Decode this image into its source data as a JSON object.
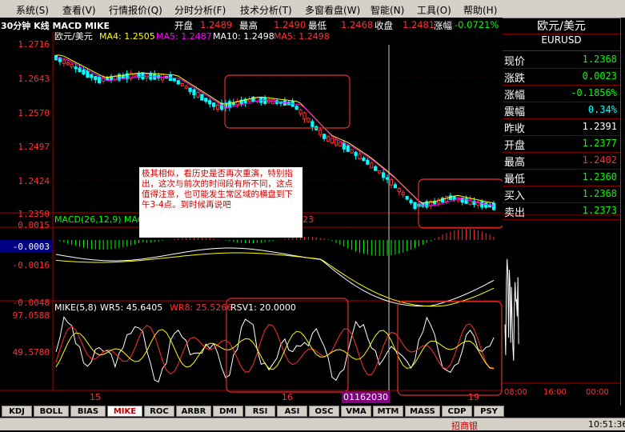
{
  "menu": [
    "系统(S)",
    "查看(V)",
    "行情报价(Q)",
    "分时分析(F)",
    "技术分析(T)",
    "多窗看盘(W)",
    "智能(N)",
    "工具(O)",
    "帮助(H)"
  ],
  "info": {
    "period": "30分钟 K线 MACD MIKE",
    "open_label": "开盘",
    "open": "1.2489",
    "high_label": "最高",
    "high": "1.2490",
    "low_label": "最低",
    "low": "1.2468",
    "close_label": "收盘",
    "close": "1.2481",
    "change_label": "涨幅",
    "change": "-0.0721%"
  },
  "main_legend": {
    "name": "欧元/美元",
    "ma4": "MA4: 1.2505",
    "ma5": "MA5: 1.2487",
    "ma10": "MA10: 1.2498",
    "ma5b": "MA5: 1.2498"
  },
  "price_axis": [
    "1.2716",
    "1.2643",
    "1.2570",
    "1.2497",
    "1.2424",
    "1.2350"
  ],
  "macd": {
    "legend": "MACD(26,12,9)",
    "legend2": "MAC",
    "legend3": "23",
    "axis": [
      "0.0015",
      "-0.0003",
      "-0.0016",
      "-0.0048"
    ]
  },
  "mike": {
    "legend": "MIKE(5,8)",
    "wr5": "WR5: 45.6405",
    "wr8": "WR8: 25.5266",
    "rsv1": "RSV1: 20.0000",
    "axis": [
      "97.0588",
      "49.5780"
    ]
  },
  "dates": [
    "15",
    "16",
    "19"
  ],
  "cursor_time": "01162030",
  "annotation": "极其相似，看历史是否再次重演，特别指出，这次与前次的时间段有所不同，这点值得注意，也可能发生常区域的横盘到下午3-4点。到时候再说吧",
  "right_panel": {
    "title": "欧元/美元",
    "code": "EURUSD",
    "rows": [
      {
        "label": "现价",
        "value": "1.2368",
        "color": "#00ff00"
      },
      {
        "label": "涨跌",
        "value": "0.0023",
        "color": "#00ff00"
      },
      {
        "label": "涨幅",
        "value": "-0.1856%",
        "color": "#00ff00"
      },
      {
        "label": "震幅",
        "value": "0.34%",
        "color": "#00ffff"
      },
      {
        "label": "昨收",
        "value": "1.2391",
        "color": "#ffffff"
      },
      {
        "label": "开盘",
        "value": "1.2377",
        "color": "#00ff00"
      },
      {
        "label": "最高",
        "value": "1.2402",
        "color": "#ff3030"
      },
      {
        "label": "最低",
        "value": "1.2360",
        "color": "#00ff00"
      },
      {
        "label": "买入",
        "value": "1.2368",
        "color": "#00ff00"
      },
      {
        "label": "卖出",
        "value": "1.2373",
        "color": "#00ff00"
      }
    ]
  },
  "mini_axis": [
    "08:00",
    "16:00",
    "00:00"
  ],
  "tabs": [
    "KDJ",
    "BOLL",
    "BIAS",
    "MIKE",
    "ROC",
    "ARBR",
    "DMI",
    "RSI",
    "ASI",
    "OSC",
    "VMA",
    "MTM",
    "MASS",
    "CDP",
    "PSY"
  ],
  "active_tab": "MIKE",
  "status": {
    "broker": "招商银",
    "clock": "10:51:36"
  },
  "colors": {
    "up": "#ff3030",
    "down": "#00ffff",
    "ma4": "#ffff00",
    "ma5": "#ff00ff",
    "ma10": "#ffffff",
    "frame": "#b00000"
  }
}
